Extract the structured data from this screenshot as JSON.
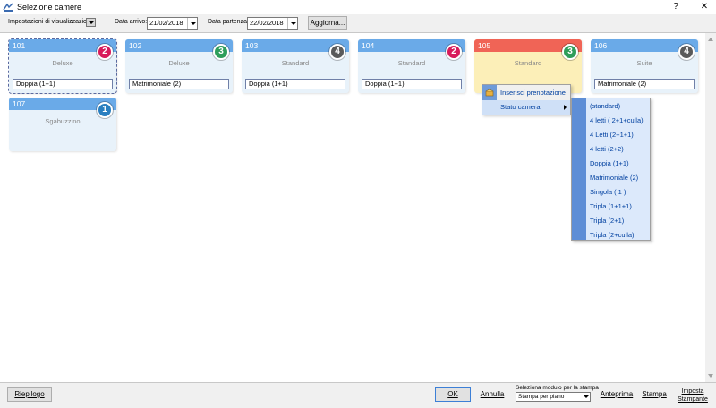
{
  "window": {
    "title": "Selezione camere",
    "help_label": "?",
    "close_label": "✕"
  },
  "toolbar": {
    "view_settings_label": "Impostazioni di visualizzazione",
    "arrival_label": "Data arrivo:",
    "arrival_value": "21/02/2018",
    "departure_label": "Data partenza:",
    "departure_value": "22/02/2018",
    "refresh_label": "Aggiorna..."
  },
  "rooms": [
    {
      "number": "101",
      "type": "Deluxe",
      "bed": "Doppia (1+1)",
      "badge": "2",
      "badge_color": "#d81b5a",
      "status": "blue",
      "selected": true
    },
    {
      "number": "102",
      "type": "Deluxe",
      "bed": "Matrimoniale (2)",
      "badge": "3",
      "badge_color": "#2e9e5a",
      "status": "blue"
    },
    {
      "number": "103",
      "type": "Standard",
      "bed": "Doppia (1+1)",
      "badge": "4",
      "badge_color": "#5a5a5a",
      "status": "blue"
    },
    {
      "number": "104",
      "type": "Standard",
      "bed": "Doppia (1+1)",
      "badge": "2",
      "badge_color": "#d81b5a",
      "status": "blue"
    },
    {
      "number": "105",
      "type": "Standard",
      "bed": "",
      "badge": "3",
      "badge_color": "#2e9e5a",
      "status": "red"
    },
    {
      "number": "106",
      "type": "Suite",
      "bed": "Matrimoniale (2)",
      "badge": "4",
      "badge_color": "#5a5a5a",
      "status": "blue"
    },
    {
      "number": "107",
      "type": "Sgabuzzino",
      "bed": "",
      "badge": "1",
      "badge_color": "#2a7fc0",
      "status": "blue"
    }
  ],
  "context_menu": {
    "items": [
      "Inserisci prenotazione",
      "Stato camera"
    ]
  },
  "submenu": {
    "items": [
      "(standard)",
      "4 letti ( 2+1+culla)",
      "4 Letti (2+1+1)",
      "4 letti (2+2)",
      "Doppia (1+1)",
      "Matrimoniale (2)",
      "Singola ( 1 )",
      "Tripla (1+1+1)",
      "Tripla (2+1)",
      "Tripla (2+culla)"
    ]
  },
  "footer": {
    "summary_label": "Riepilogo",
    "ok_label": "OK",
    "cancel_label": "Annulla",
    "print_module_caption": "Seleziona modulo per la stampa",
    "print_module_value": "Stampa per piano",
    "preview_label": "Anteprima",
    "print_label": "Stampa",
    "printer_setup_line1": "Imposta",
    "printer_setup_line2": "Stampante"
  }
}
